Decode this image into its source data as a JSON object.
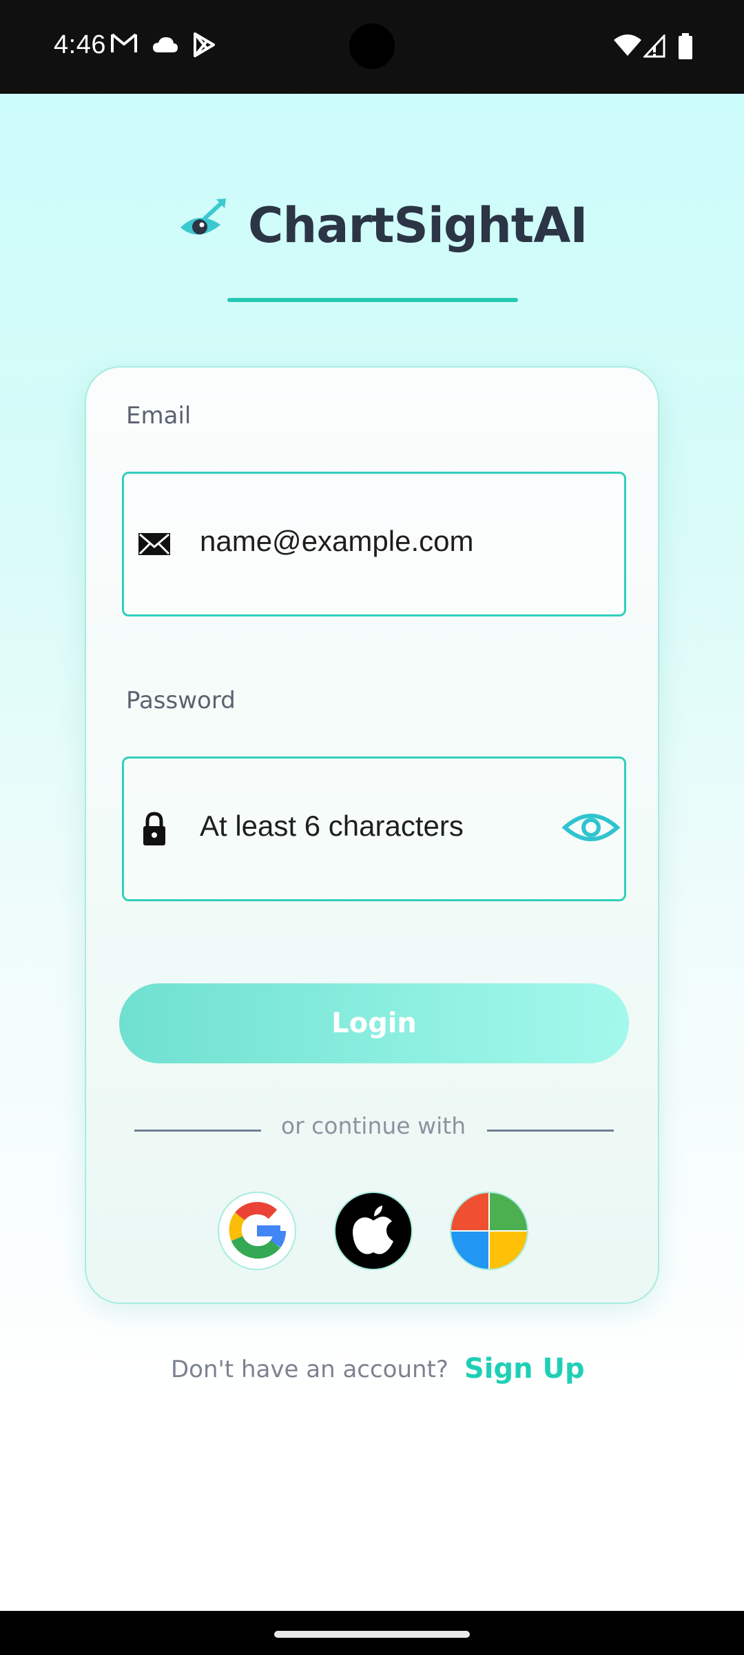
{
  "status_bar": {
    "time": "4:46",
    "icons": [
      "gmail-icon",
      "cloud-icon",
      "play-store-icon",
      "wifi-icon",
      "signal-icon",
      "battery-icon"
    ]
  },
  "app": {
    "title": "ChartSightAI",
    "logo_icon": "eye-arrow-logo-icon",
    "accent_color": "#26c9b2",
    "title_color": "#2b3545"
  },
  "form": {
    "email": {
      "label": "Email",
      "placeholder": "name@example.com",
      "icon": "envelope-icon"
    },
    "password": {
      "label": "Password",
      "placeholder": "At least 6 characters",
      "icon": "lock-icon",
      "toggle_icon": "eye-icon"
    },
    "login_label": "Login",
    "divider_text": "or continue with",
    "social": [
      {
        "name": "google",
        "icon": "google-icon"
      },
      {
        "name": "apple",
        "icon": "apple-icon"
      },
      {
        "name": "microsoft",
        "icon": "microsoft-icon"
      }
    ]
  },
  "signup": {
    "prompt": "Don't have an account?",
    "link_label": "Sign Up"
  }
}
